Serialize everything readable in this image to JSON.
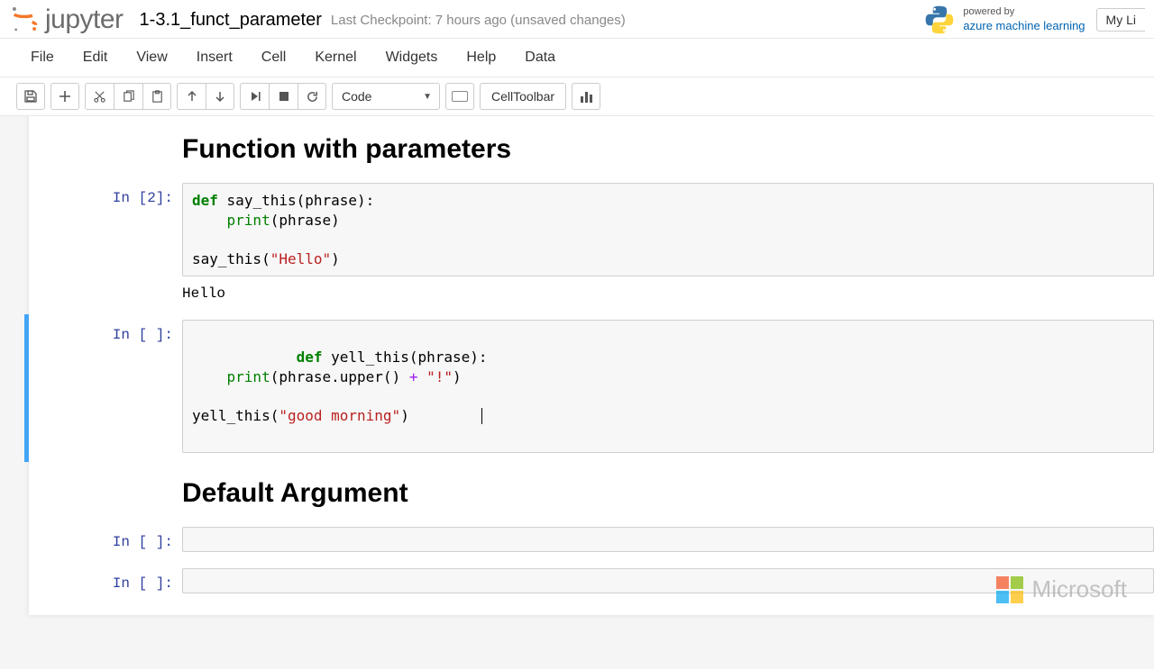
{
  "header": {
    "logo_text": "jupyter",
    "title": "1-3.1_funct_parameter",
    "checkpoint": "Last Checkpoint: 7 hours ago (unsaved changes)",
    "powered_small": "powered by",
    "powered_brand": "azure machine learning",
    "mylib_label": "My Li"
  },
  "menu": {
    "items": [
      "File",
      "Edit",
      "View",
      "Insert",
      "Cell",
      "Kernel",
      "Widgets",
      "Help",
      "Data"
    ]
  },
  "toolbar": {
    "celltype": "Code",
    "celltoolbar": "CellToolbar"
  },
  "notebook": {
    "heading1": "Function with parameters",
    "heading2": "Default Argument",
    "cells": [
      {
        "prompt": "In [2]:",
        "code_html": "<span class='kw'>def</span> <span class='fn'>say_this</span>(phrase):\n    <span class='bi'>print</span>(phrase)\n\nsay_this(<span class='str'>\"Hello\"</span>)",
        "output": "Hello"
      },
      {
        "prompt": "In [ ]:",
        "code_html": "<span class='kw'>def</span> <span class='fn'>yell_this</span>(phrase):\n    <span class='bi'>print</span>(phrase.upper() <span class='op'>+</span> <span class='str'>\"!\"</span>)\n\nyell_this(<span class='str'>\"good morning\"</span>)",
        "selected": true
      },
      {
        "prompt": "In [ ]:",
        "code_html": ""
      },
      {
        "prompt": "In [ ]:",
        "code_html": ""
      }
    ]
  },
  "footer": {
    "ms": "Microsoft"
  }
}
